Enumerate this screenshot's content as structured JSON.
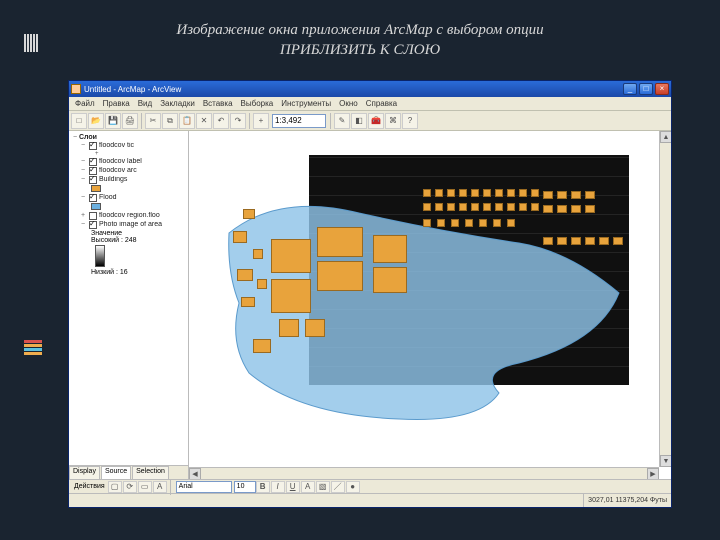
{
  "slide": {
    "caption_line1": "Изображение окна приложения ArcMap с выбором опции",
    "caption_line2": "ПРИБЛИЗИТЬ К СЛОЮ"
  },
  "titlebar": {
    "title": "Untitled - ArcMap - ArcView",
    "min": "_",
    "max": "□",
    "close": "×"
  },
  "menu": {
    "file": "Файл",
    "edit": "Правка",
    "view": "Вид",
    "bookmarks": "Закладки",
    "insert": "Вставка",
    "selection": "Выборка",
    "tools": "Инструменты",
    "window": "Окно",
    "help": "Справка"
  },
  "toolbar": {
    "scale": "1:3,492"
  },
  "toc": {
    "root": "Слои",
    "layers": [
      {
        "name": "floodcov tic"
      },
      {
        "name": "floodcov label"
      },
      {
        "name": "floodcov arc"
      },
      {
        "name": "Buildings"
      },
      {
        "name": "Flood"
      },
      {
        "name": "floodcov region.floo"
      },
      {
        "name": "Photo image of area"
      }
    ],
    "raster_label": "Значение",
    "raster_high": "Высокий : 248",
    "raster_low": "Низкий : 16",
    "tab_display": "Display",
    "tab_source": "Source",
    "tab_selection": "Selection"
  },
  "drawbar": {
    "label": "Действия",
    "font": "Arial",
    "size": "10",
    "bold": "B",
    "italic": "I",
    "underline": "U",
    "align": "A"
  },
  "status": {
    "coords": "3027,01  11375,204 Футы"
  }
}
